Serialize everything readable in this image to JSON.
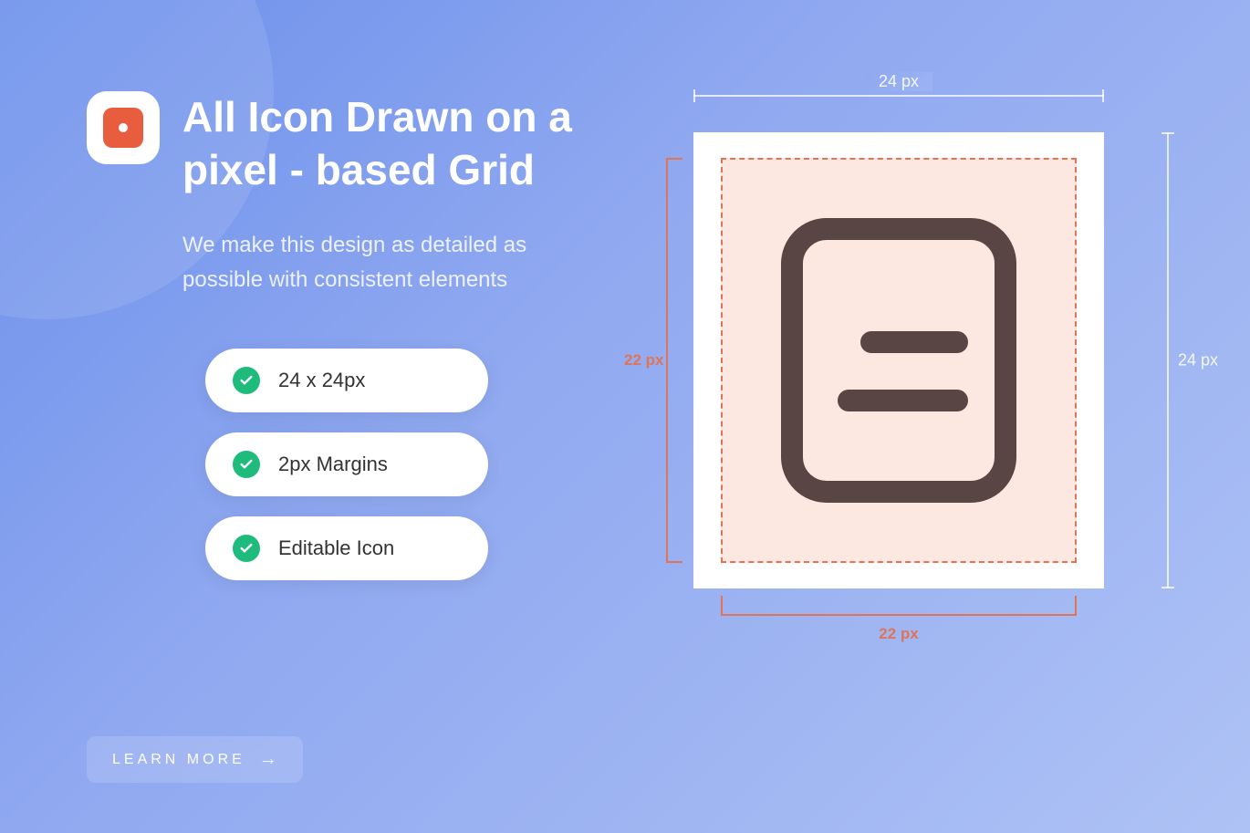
{
  "header": {
    "title": "All Icon Drawn on a pixel - based Grid",
    "subtitle": "We make this design as detailed as possible with consistent elements"
  },
  "features": [
    {
      "label": "24 x 24px"
    },
    {
      "label": "2px Margins"
    },
    {
      "label": "Editable Icon"
    }
  ],
  "cta": {
    "label": "LEARN MORE"
  },
  "diagram": {
    "outer_width": "24 px",
    "outer_height": "24 px",
    "inner_width": "22 px",
    "inner_height": "22 px"
  }
}
